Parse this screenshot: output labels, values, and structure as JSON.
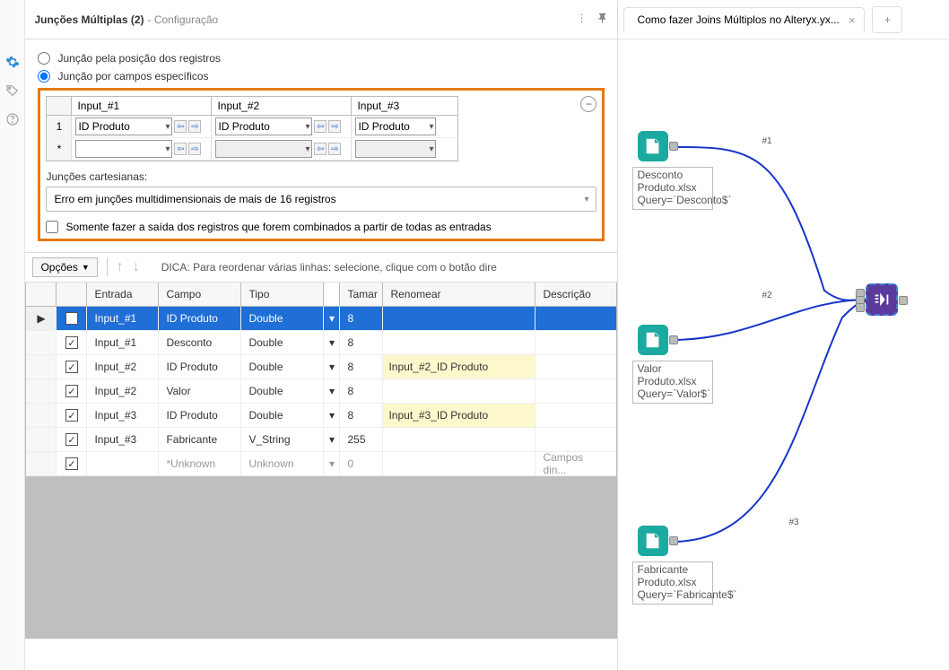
{
  "header": {
    "tool_name": "Junções Múltiplas (2)",
    "suffix": "- Configuração"
  },
  "radios": {
    "by_position": "Junção pela posição dos registros",
    "by_fields": "Junção por campos específicos"
  },
  "join_fields": {
    "headers": [
      "Input_#1",
      "Input_#2",
      "Input_#3"
    ],
    "row1_num": "1",
    "row2_num": "*",
    "value_idprod": "ID Produto"
  },
  "cartesian_label": "Junções cartesianas:",
  "cartesian_value": "Erro em junções multidimensionais de mais de 16 registros",
  "only_joined": "Somente fazer a saída dos registros que forem combinados a partir de todas as entradas",
  "opts_label": "Opções",
  "tip_text": "DICA: Para reordenar várias linhas: selecione, clique com o botão dire",
  "grid_headers": {
    "entrada": "Entrada",
    "campo": "Campo",
    "tipo": "Tipo",
    "tamanho": "Tamar",
    "renomear": "Renomear",
    "descricao": "Descrição"
  },
  "rows": [
    {
      "sel": true,
      "src": "Input_#1",
      "field": "ID Produto",
      "type": "Double",
      "size": "8",
      "rename": "",
      "desc": "",
      "chk": true
    },
    {
      "sel": false,
      "src": "Input_#1",
      "field": "Desconto",
      "type": "Double",
      "size": "8",
      "rename": "",
      "desc": "",
      "chk": true
    },
    {
      "sel": false,
      "src": "Input_#2",
      "field": "ID Produto",
      "type": "Double",
      "size": "8",
      "rename": "Input_#2_ID Produto",
      "desc": "",
      "chk": true
    },
    {
      "sel": false,
      "src": "Input_#2",
      "field": "Valor",
      "type": "Double",
      "size": "8",
      "rename": "",
      "desc": "",
      "chk": true
    },
    {
      "sel": false,
      "src": "Input_#3",
      "field": "ID Produto",
      "type": "Double",
      "size": "8",
      "rename": "Input_#3_ID Produto",
      "desc": "",
      "chk": true
    },
    {
      "sel": false,
      "src": "Input_#3",
      "field": "Fabricante",
      "type": "V_String",
      "size": "255",
      "rename": "",
      "desc": "",
      "chk": true
    },
    {
      "sel": false,
      "src": "",
      "field": "*Unknown",
      "type": "Unknown",
      "size": "0",
      "rename": "",
      "desc": "Campos din...",
      "chk": true,
      "dim": true
    }
  ],
  "tab_name": "Como fazer Joins Múltiplos no Alteryx.yx...",
  "canvas": {
    "n1_label": "Desconto Produto.xlsx\nQuery=`Desconto$`",
    "n2_label": "Valor Produto.xlsx\nQuery=`Valor$`",
    "n3_label": "Fabricante Produto.xlsx\nQuery=`Fabricante$`",
    "e1": "#1",
    "e2": "#2",
    "e3": "#3"
  }
}
